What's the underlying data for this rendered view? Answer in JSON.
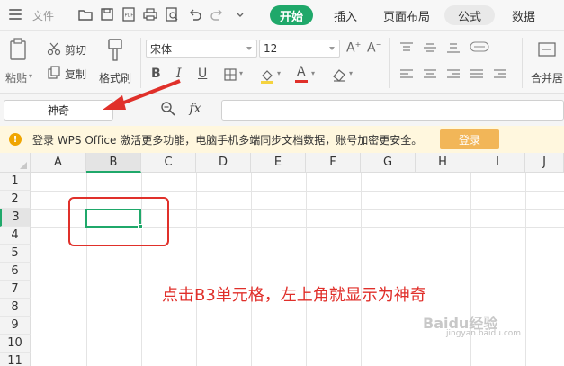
{
  "menubar": {
    "file": "文件",
    "tabs": [
      "开始",
      "插入",
      "页面布局",
      "公式",
      "数据"
    ]
  },
  "ribbon": {
    "paste": "粘贴",
    "cut": "剪切",
    "copy": "复制",
    "format_painter": "格式刷",
    "font_name": "宋体",
    "font_size": "12",
    "merge_center": "合并居"
  },
  "formula_bar": {
    "name_box": "神奇",
    "fx": "fx",
    "formula_value": ""
  },
  "notice": {
    "text": "登录 WPS Office 激活更多功能，电脑手机多端同步文档数据，账号加密更安全。",
    "button": "登录"
  },
  "sheet": {
    "columns": [
      "A",
      "B",
      "C",
      "D",
      "E",
      "F",
      "G",
      "H",
      "I",
      "J"
    ],
    "rows": [
      "1",
      "2",
      "3",
      "4",
      "5",
      "6",
      "7",
      "8",
      "9",
      "10",
      "11"
    ],
    "active_cell": "B3"
  },
  "annotation": {
    "text": "点击B3单元格，左上角就显示为神奇"
  },
  "watermark": {
    "brand": "Baidu经验",
    "url": "jingyan.baidu.com"
  },
  "colors": {
    "accent": "#1fa86a",
    "annotation_red": "#e0302a",
    "login_button": "#f2b658"
  }
}
